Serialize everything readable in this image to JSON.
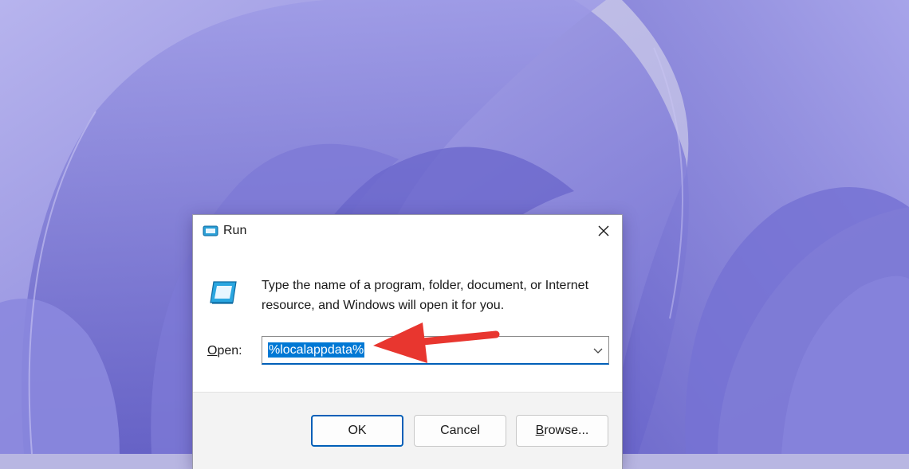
{
  "dialog": {
    "title": "Run",
    "description": "Type the name of a program, folder, document, or Internet resource, and Windows will open it for you.",
    "open_label_prefix": "",
    "open_label_underlined": "O",
    "open_label_rest": "pen:",
    "input_value": "%localappdata%",
    "buttons": {
      "ok": "OK",
      "cancel": "Cancel",
      "browse_underlined": "B",
      "browse_rest": "rowse..."
    }
  },
  "colors": {
    "accent": "#005fb8",
    "selection": "#0078d4",
    "annotation_arrow": "#e8362f",
    "wallpaper": "#8c8ad6"
  },
  "icons": [
    "run-app-icon",
    "run-app-large-icon",
    "close-icon",
    "chevron-down-icon",
    "annotation-arrow-icon"
  ]
}
